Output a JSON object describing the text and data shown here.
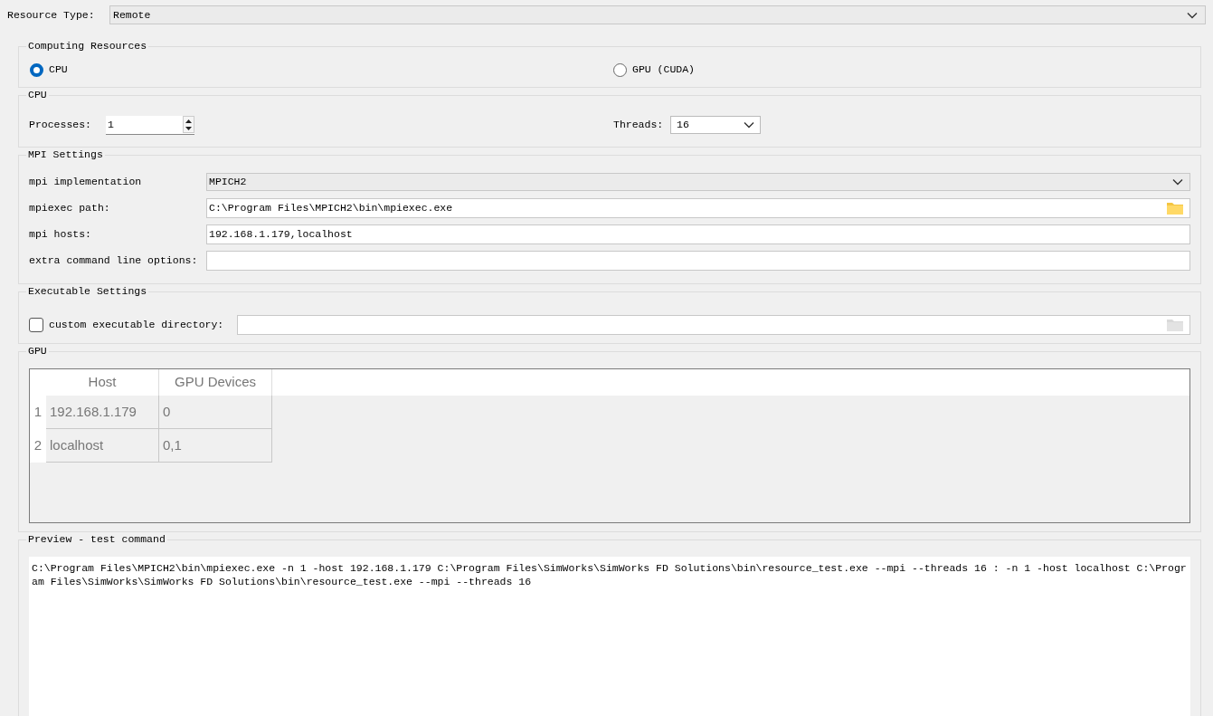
{
  "resource_type": {
    "label": "Resource Type:",
    "value": "Remote"
  },
  "computing_resources": {
    "title": "Computing Resources",
    "options": [
      {
        "label": "CPU",
        "selected": true
      },
      {
        "label": "GPU (CUDA)",
        "selected": false
      }
    ]
  },
  "cpu": {
    "title": "CPU",
    "processes": {
      "label": "Processes:",
      "value": "1"
    },
    "threads": {
      "label": "Threads:",
      "value": "16"
    }
  },
  "mpi_settings": {
    "title": "MPI Settings",
    "fields": [
      {
        "kind": "dropdown",
        "label": "mpi implementation",
        "value": "MPICH2"
      },
      {
        "kind": "path",
        "label": "mpiexec path:",
        "value": "C:\\Program Files\\MPICH2\\bin\\mpiexec.exe"
      },
      {
        "kind": "text",
        "label": "mpi hosts:",
        "value": "192.168.1.179,localhost"
      },
      {
        "kind": "text",
        "label": "extra command line options:"
      }
    ]
  },
  "executable_settings": {
    "title": "Executable Settings",
    "custom_directory": {
      "label": "custom executable directory:",
      "checked": false
    }
  },
  "gpu": {
    "title": "GPU",
    "table": {
      "columns": [
        "Host",
        "GPU Devices"
      ],
      "rows": [
        {
          "number": "1",
          "cells": [
            "192.168.1.179",
            "0"
          ]
        },
        {
          "number": "2",
          "cells": [
            "localhost",
            "0,1"
          ]
        }
      ]
    }
  },
  "preview": {
    "title": "Preview - test command",
    "text": "C:\\Program Files\\MPICH2\\bin\\mpiexec.exe -n 1 -host 192.168.1.179 C:\\Program Files\\SimWorks\\SimWorks FD Solutions\\bin\\resource_test.exe --mpi --threads 16 : -n 1 -host localhost C:\\Program Files\\SimWorks\\SimWorks FD Solutions\\bin\\resource_test.exe --mpi --threads 16"
  }
}
